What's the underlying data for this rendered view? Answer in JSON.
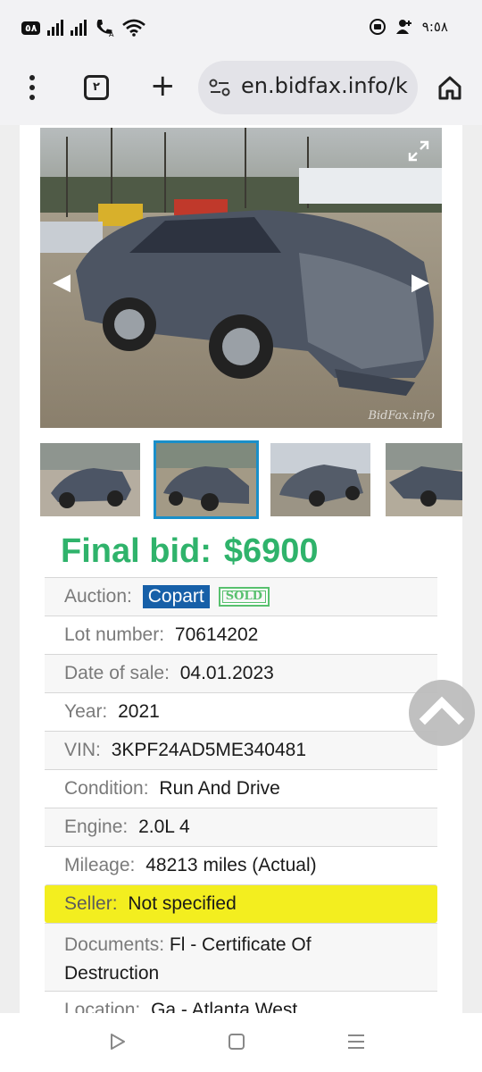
{
  "status_bar": {
    "badge": "٥٨",
    "time": "٩:٥٨",
    "icons": [
      "signal-bars-icon",
      "signal-bars-icon",
      "wifi-calling-icon",
      "wifi-icon",
      "media-icon",
      "person-icon"
    ]
  },
  "browser": {
    "url": "en.bidfax.info/k",
    "tabs_count": "٢",
    "icons": [
      "more-vert-icon",
      "tab-switcher-icon",
      "new-tab-icon",
      "site-info-icon",
      "home-icon"
    ]
  },
  "gallery": {
    "watermark": "BidFax.info",
    "selected_thumb": 1
  },
  "listing": {
    "final_bid_label": "Final bid:",
    "final_bid_value": "$6900",
    "auction_label": "Auction: ",
    "auction_value": "Copart",
    "sold_badge": "SOLD",
    "rows": [
      {
        "label": "Lot number: ",
        "value": "70614202"
      },
      {
        "label": "Date of sale: ",
        "value": "04.01.2023"
      },
      {
        "label": "Year: ",
        "value": "2021"
      },
      {
        "label": "VIN: ",
        "value": "3KPF24AD5ME340481"
      },
      {
        "label": "Condition: ",
        "value": "Run And Drive"
      },
      {
        "label": "Engine: ",
        "value": "2.0L 4"
      },
      {
        "label": "Mileage: ",
        "value": "48213 miles (Actual)"
      }
    ],
    "seller_label": "Seller: ",
    "seller_value": "Not specified",
    "documents_label": "Documents: ",
    "documents_value_line1": "Fl - Certificate Of",
    "documents_value_line2": "Destruction",
    "location_label": "Location: ",
    "location_value": "Ga - Atlanta West"
  },
  "colors": {
    "final_bid": "#2fb36b",
    "auction_badge": "#1760a8",
    "seller_highlight": "#f3ee1f",
    "thumb_selected": "#1a8fc9"
  }
}
